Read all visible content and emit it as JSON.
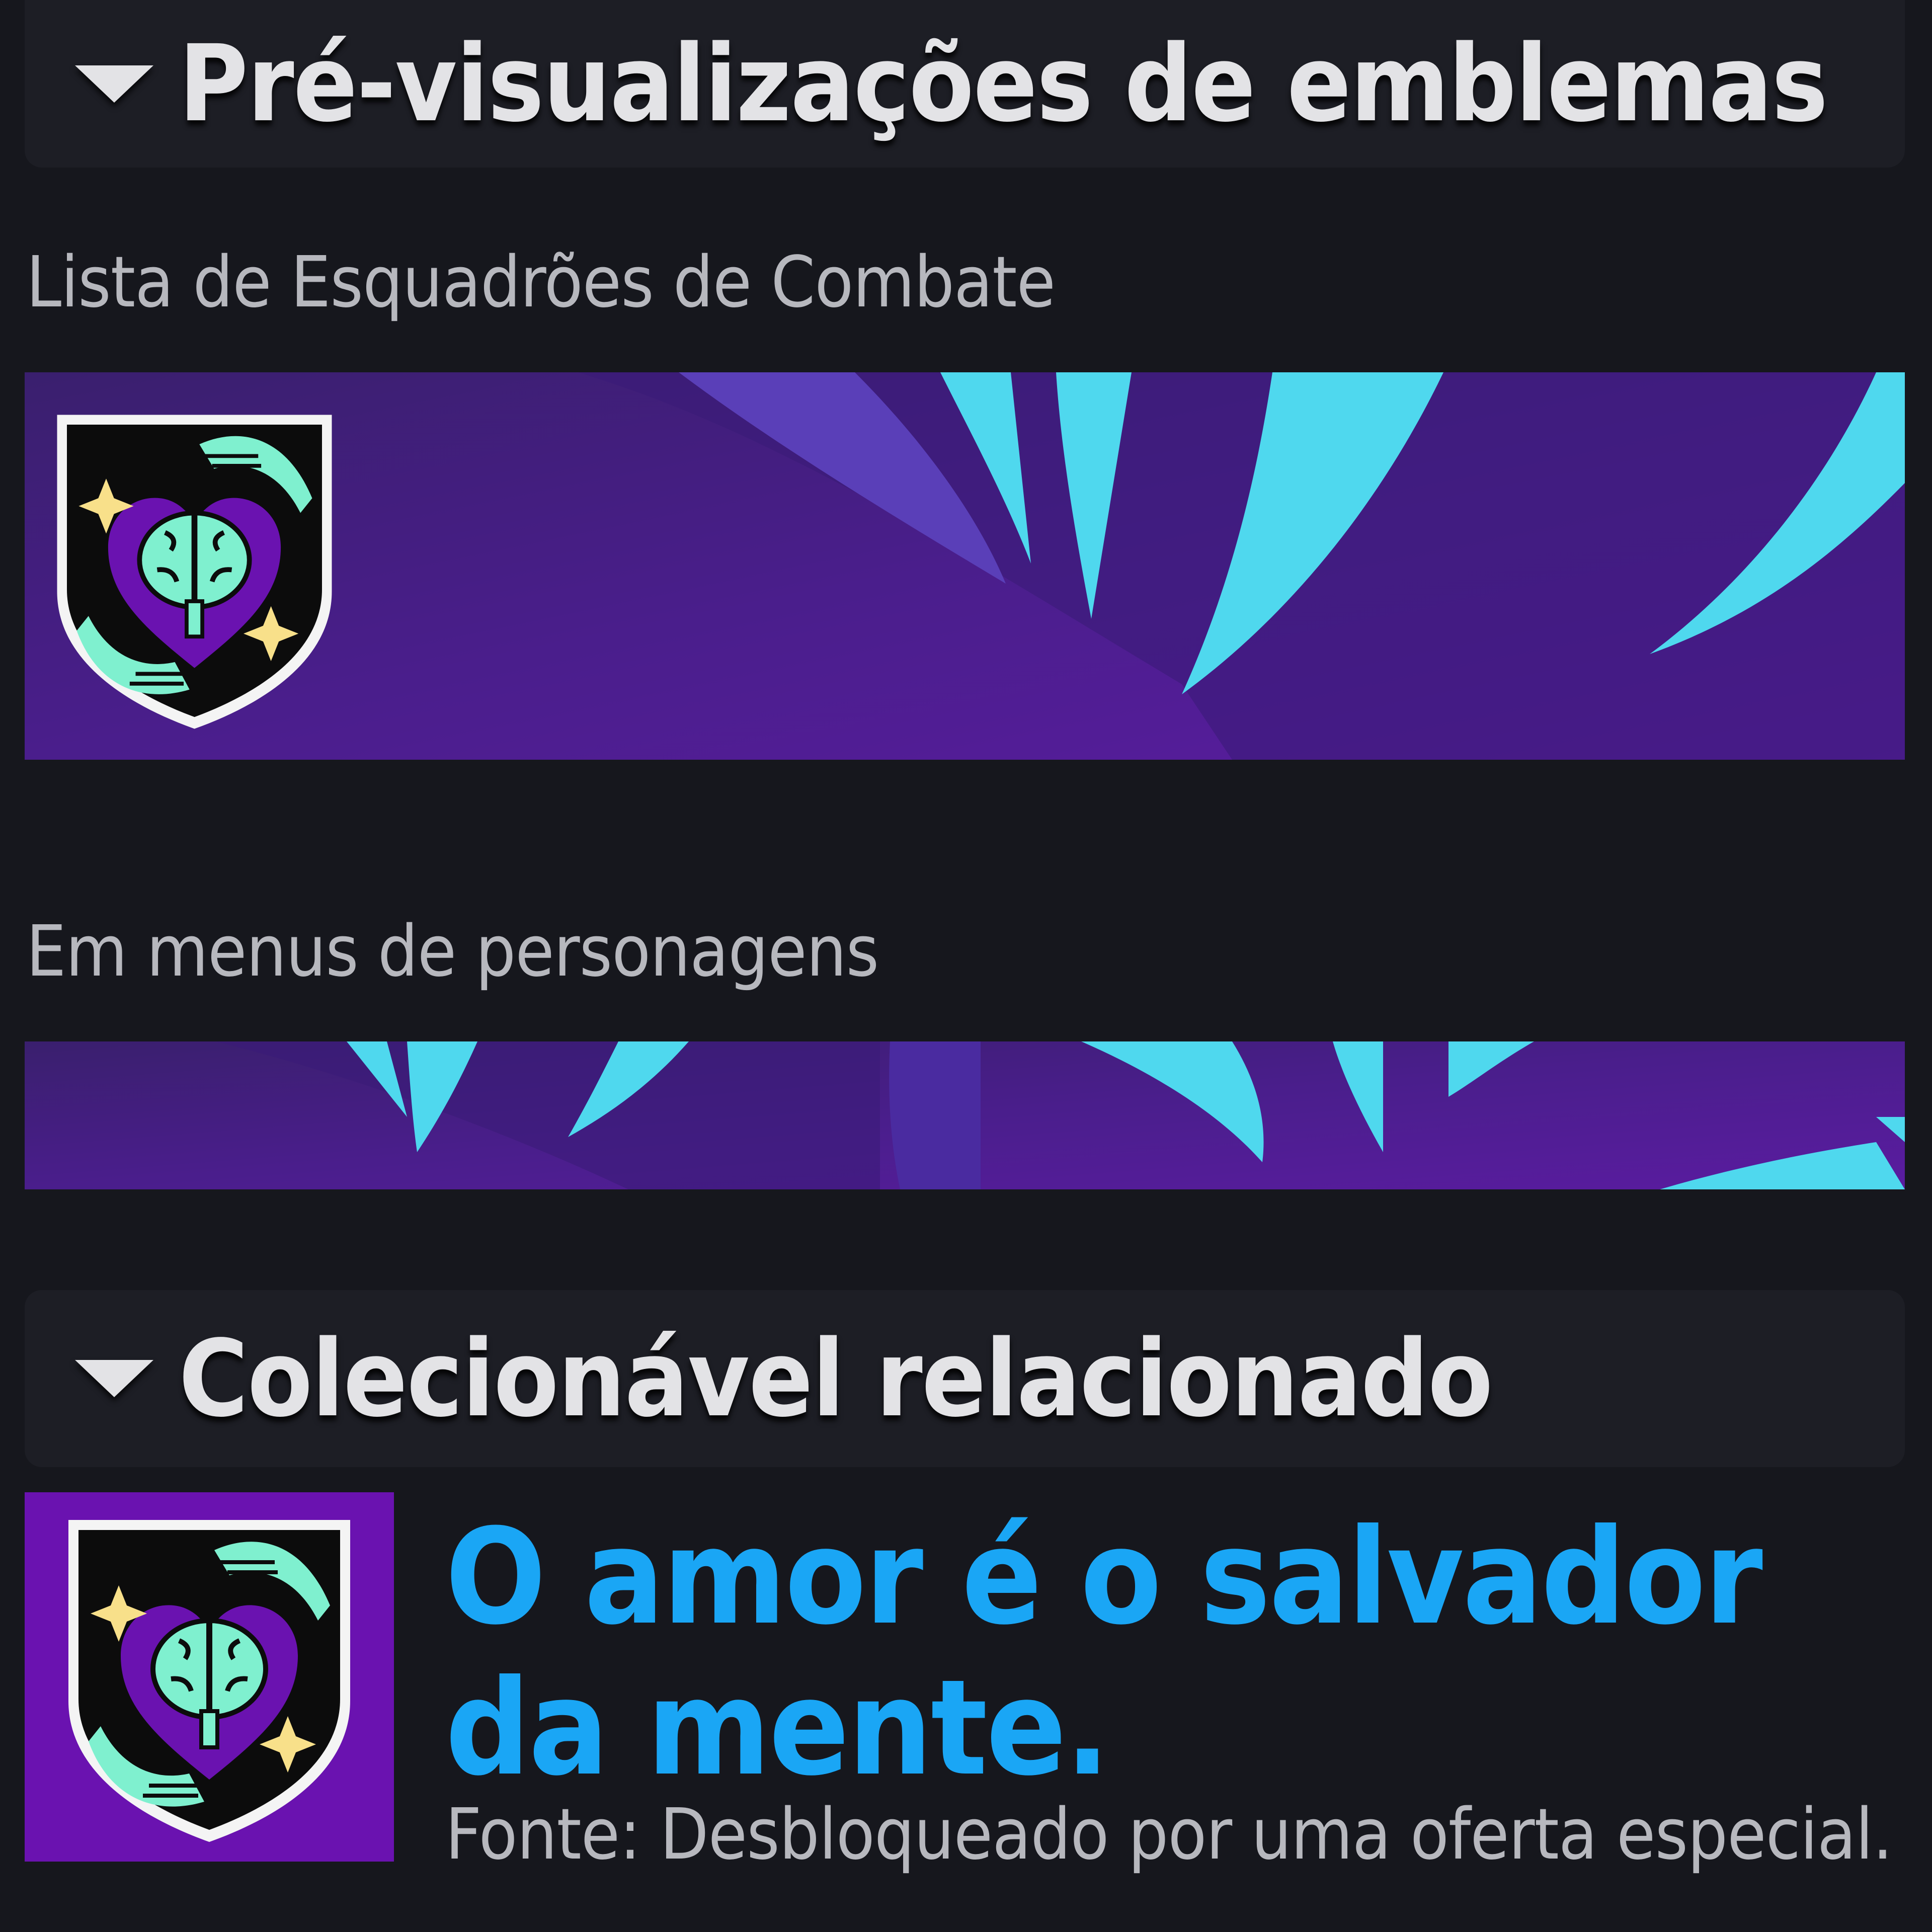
{
  "emblem_previews": {
    "header": "Pré-visualizações de emblemas",
    "roster_label": "Lista de Esquadrões de Combate",
    "character_menu_label": "Em menus de personagens"
  },
  "related_collectible": {
    "header": "Colecionável relacionado",
    "title": "O amor é o salvador da mente.",
    "source": "Fonte: Desbloqueado por uma oferta especial."
  },
  "colors": {
    "background": "#16171d",
    "header_background": "#1d1e25",
    "banner_purple": "#4a1e8c",
    "accent_cyan": "#4fd8ee",
    "title_blue": "#1aa6f5",
    "tile_purple": "#6a12b0",
    "emblem_mint": "#6ee8c8"
  },
  "icons": [
    "collapse-triangle-icon",
    "emblem-shield-icon",
    "brain-heart-icon",
    "hands-icon",
    "sparkle-icon"
  ]
}
